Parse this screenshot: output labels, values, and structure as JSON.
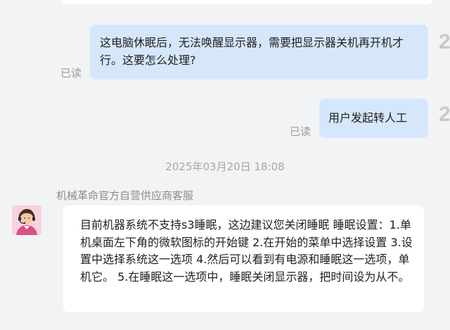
{
  "messages": {
    "user_message_1": "这电脑休眠后，无法唤醒显示器，需要把显示器关机再开机才行。这要怎么处理?",
    "user_message_2": "用户发起转人工",
    "read_label": "已读"
  },
  "timestamp": "2025年03月20日 18:08",
  "agent": {
    "name": "机械革命官方自营供应商客服",
    "reply": "目前机器系统不支持s3睡眠，这边建议您关闭睡眠 睡眠设置：1.单机桌面左下角的微软图标的开始键 2.在开始的菜单中选择设置 3.设置中选择系统这一选项 4.然后可以看到有电源和睡眠这一选项，单机它。 5.在睡眠这一选项中，睡眠关闭显示器，把时间设为从不。"
  },
  "colors": {
    "background": "#f2f3f5",
    "user_bubble": "#d6e7fc",
    "agent_bubble": "#ffffff"
  }
}
